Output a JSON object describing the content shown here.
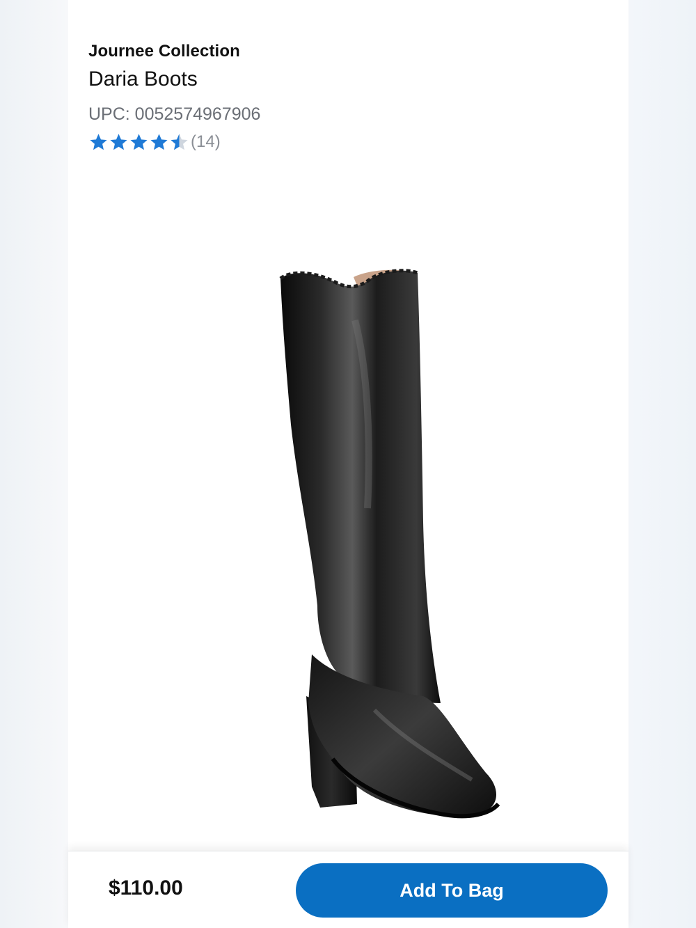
{
  "product": {
    "brand": "Journee Collection",
    "title": "Daria Boots",
    "upc": "UPC: 0052574967906",
    "rating": {
      "value": 4.5,
      "max": 5,
      "review_count": "(14)",
      "star_color": "#1f7ad6",
      "empty_star_color": "#cfd6df"
    },
    "image_icon": "black-knee-high-boot"
  },
  "purchase_bar": {
    "price": "$110.00",
    "add_to_bag_label": "Add To Bag",
    "button_color": "#0a6fc2"
  }
}
